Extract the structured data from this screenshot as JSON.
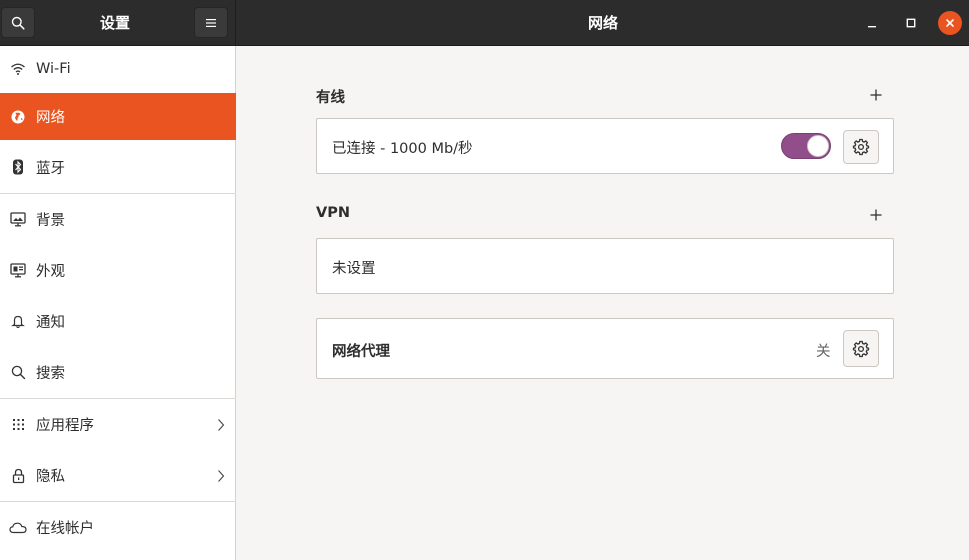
{
  "header": {
    "sidebar_title": "设置",
    "main_title": "网络",
    "search_icon": "search-icon",
    "menu_icon": "hamburger-menu-icon"
  },
  "sidebar": {
    "items": [
      {
        "label": "Wi-Fi",
        "icon": "wifi-icon"
      },
      {
        "label": "网络",
        "icon": "network-globe-icon",
        "active": true
      },
      {
        "label": "蓝牙",
        "icon": "bluetooth-icon"
      },
      {
        "label": "背景",
        "icon": "display-background-icon"
      },
      {
        "label": "外观",
        "icon": "appearance-icon"
      },
      {
        "label": "通知",
        "icon": "bell-icon"
      },
      {
        "label": "搜索",
        "icon": "search-icon"
      },
      {
        "label": "应用程序",
        "icon": "apps-grid-icon",
        "chevron": true
      },
      {
        "label": "隐私",
        "icon": "lock-icon",
        "chevron": true
      },
      {
        "label": "在线帐户",
        "icon": "cloud-icon"
      }
    ]
  },
  "main": {
    "wired": {
      "title": "有线",
      "status": "已连接 - 1000 Mb/秒",
      "enabled": true
    },
    "vpn": {
      "title": "VPN",
      "status": "未设置"
    },
    "proxy": {
      "title": "网络代理",
      "state": "关"
    }
  },
  "colors": {
    "accent": "#e95420",
    "toggle_on": "#924d8b",
    "headerbar": "#2c2c2c"
  }
}
